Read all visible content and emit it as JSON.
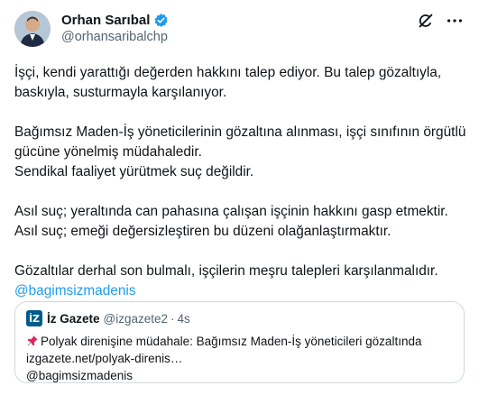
{
  "author": {
    "name": "Orhan Sarıbal",
    "handle": "@orhansaribalchp"
  },
  "tweet": {
    "paragraphs": [
      [
        "İşçi, kendi yarattığı değerden hakkını talep ediyor. Bu talep gözaltıyla,",
        "baskıyla, susturmayla karşılanıyor."
      ],
      [
        "Bağımsız Maden-İş yöneticilerinin gözaltına alınması, işçi sınıfının örgütlü",
        "gücüne yönelmiş müdahaledir.",
        "Sendikal faaliyet yürütmek suç değildir."
      ],
      [
        "Asıl suç; yeraltında can pahasına çalışan işçinin hakkını gasp etmektir.",
        "Asıl suç; emeği değersizleştiren bu düzeni olağanlaştırmaktır."
      ],
      [
        "Gözaltılar derhal son bulmalı, işçilerin meşru talepleri karşılanmalıdır."
      ]
    ],
    "hashtag": "@bagimsizmadenis"
  },
  "quote": {
    "logo_text": "İZ",
    "name": "İz Gazete",
    "handle": "@izgazete2",
    "separator": "·",
    "time": "4s",
    "lines": [
      "Polyak direnişine müdahale: Bağımsız Maden-İş yöneticileri gözaltında",
      "izgazete.net/polyak-direnis…",
      "@bagimsizmadenis"
    ]
  },
  "icons": {
    "verified": "verified-badge-icon",
    "grok": "grok-icon",
    "more": "more-icon",
    "pin": "pushpin-icon"
  },
  "colors": {
    "link": "#1d9bf0",
    "secondary_text": "#536471",
    "border": "#cfd9de"
  }
}
